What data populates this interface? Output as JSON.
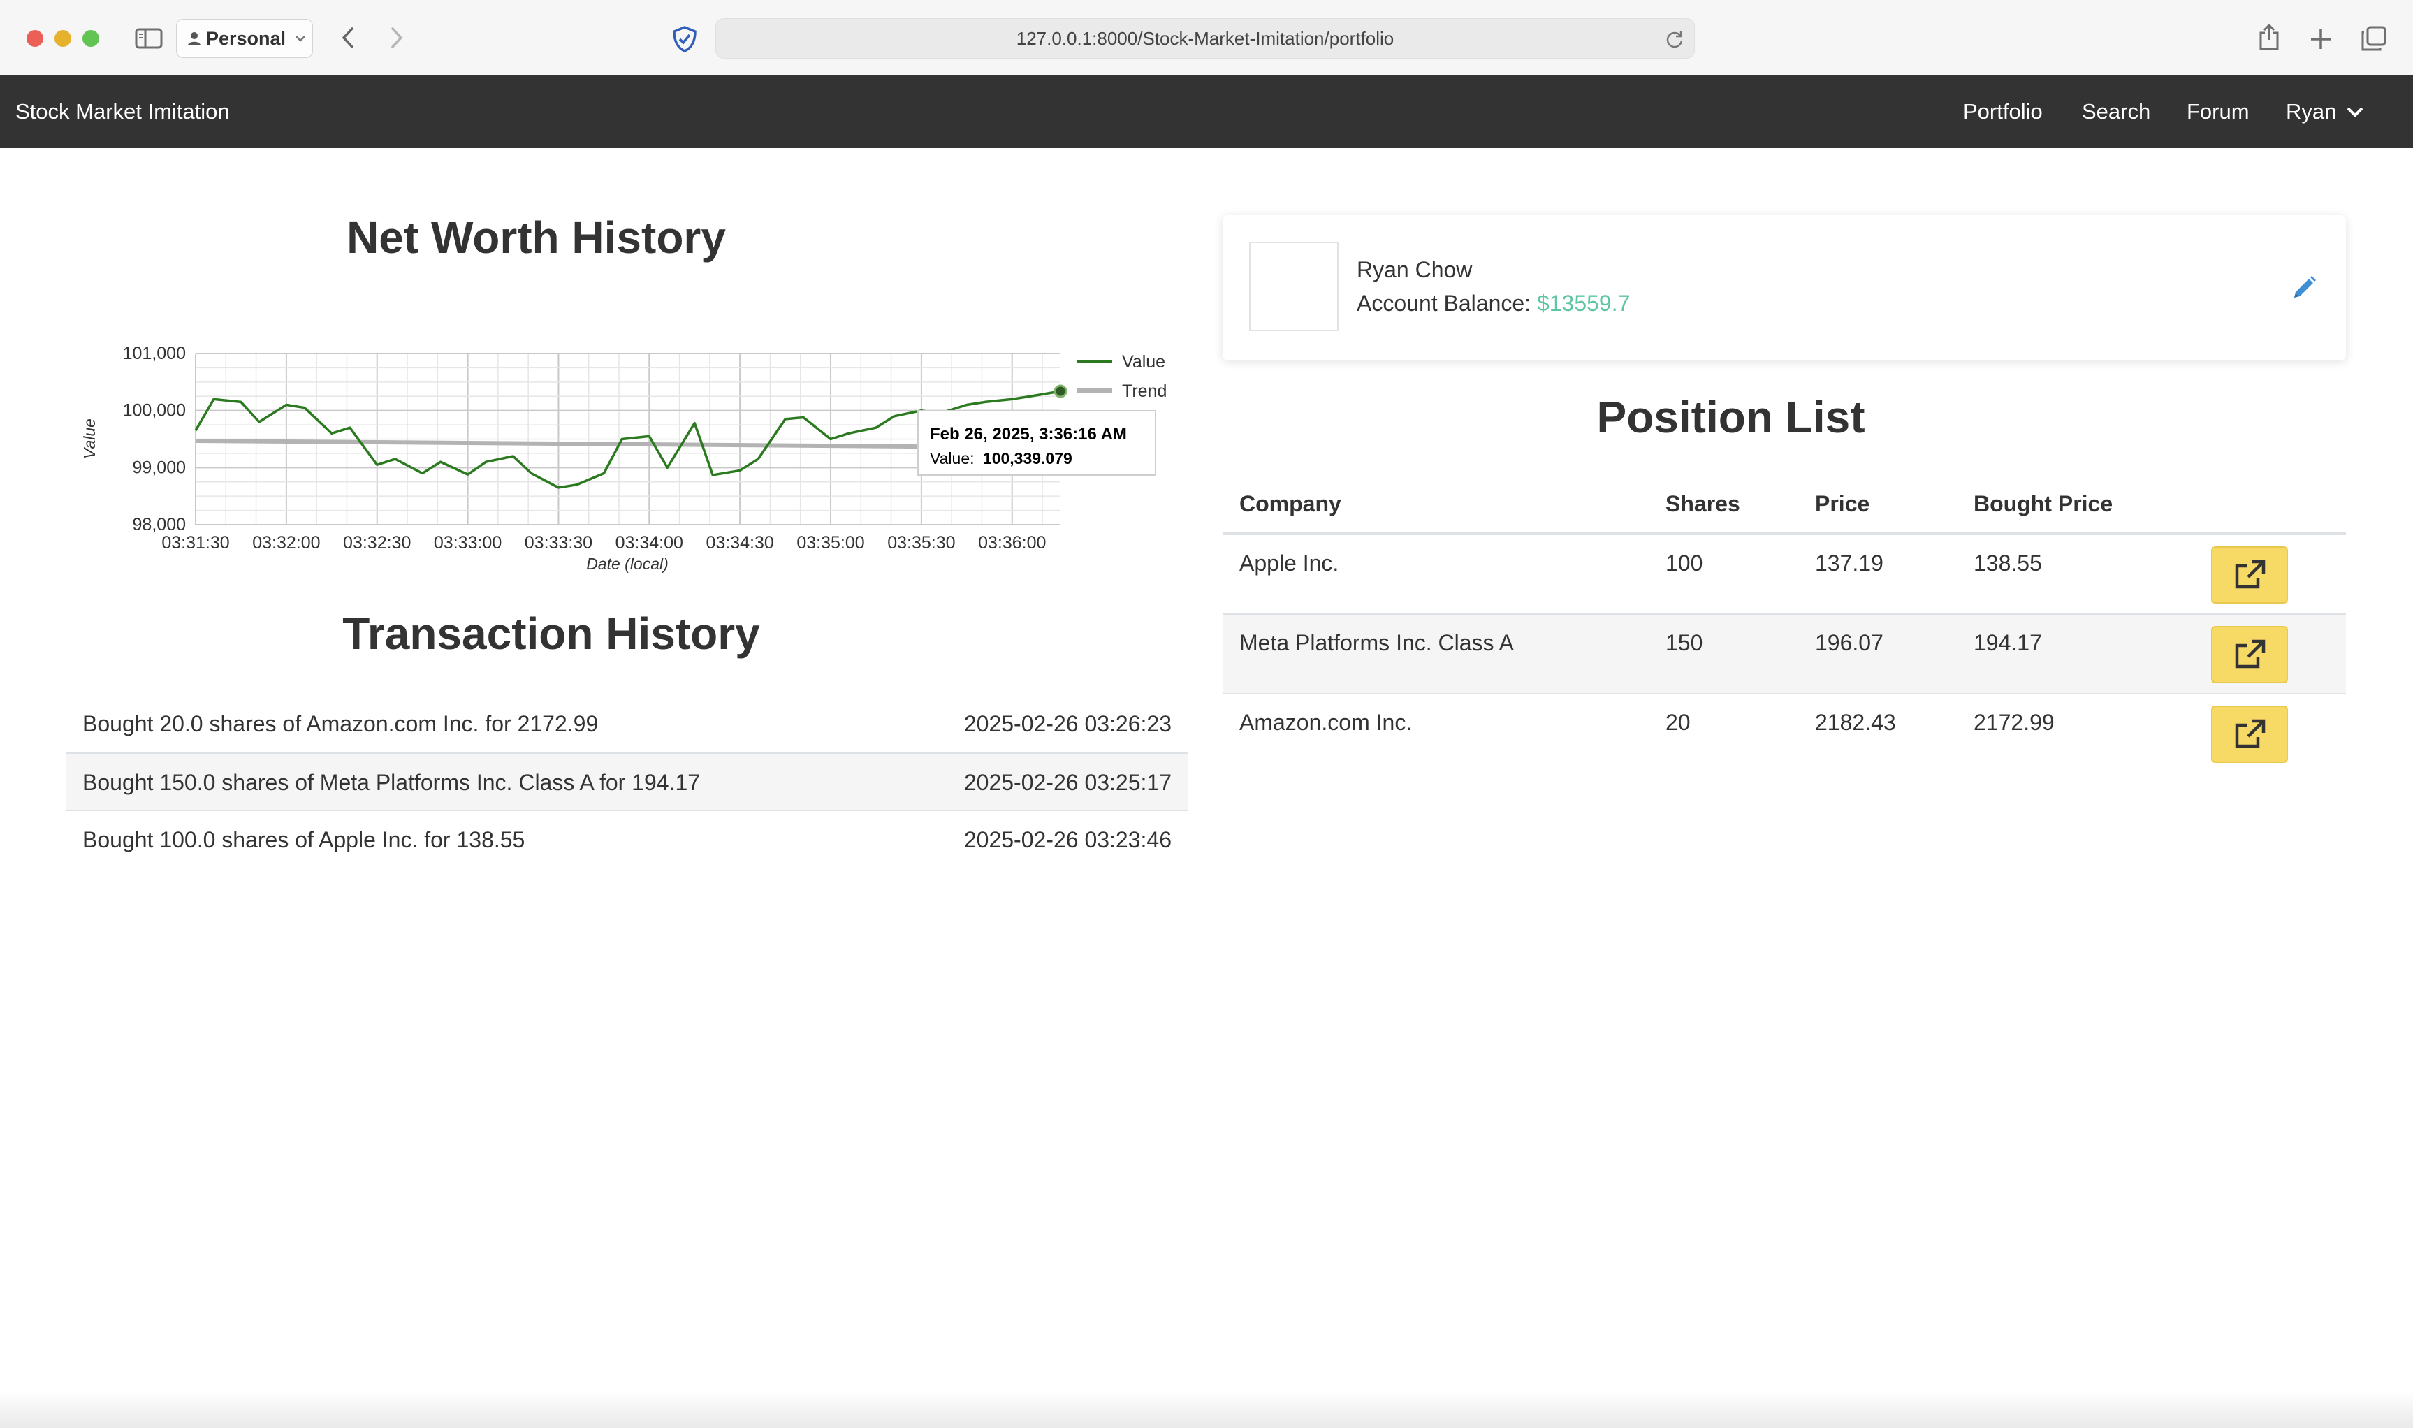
{
  "browser": {
    "profile_label": "Personal",
    "url": "127.0.0.1:8000/Stock-Market-Imitation/portfolio"
  },
  "navbar": {
    "brand": "Stock Market Imitation",
    "links": [
      "Portfolio",
      "Search",
      "Forum"
    ],
    "user_menu": "Ryan"
  },
  "net_worth": {
    "title": "Net Worth History"
  },
  "chart_data": {
    "type": "line",
    "xlabel": "Date (local)",
    "ylabel": "Value",
    "x_ticks": [
      "03:31:30",
      "03:32:00",
      "03:32:30",
      "03:33:00",
      "03:33:30",
      "03:34:00",
      "03:34:30",
      "03:35:00",
      "03:35:30",
      "03:36:00"
    ],
    "y_ticks": [
      "98,000",
      "99,000",
      "100,000",
      "101,000"
    ],
    "xlim": [
      "03:31:30",
      "03:36:16"
    ],
    "ylim": [
      98000,
      101000
    ],
    "grid": true,
    "legend": "right",
    "series": [
      {
        "name": "Value",
        "color": "#2b7a1f",
        "x": [
          "03:31:30",
          "03:31:36",
          "03:31:45",
          "03:31:51",
          "03:32:00",
          "03:32:06",
          "03:32:15",
          "03:32:21",
          "03:32:30",
          "03:32:36",
          "03:32:45",
          "03:32:51",
          "03:33:00",
          "03:33:06",
          "03:33:15",
          "03:33:21",
          "03:33:30",
          "03:33:36",
          "03:33:45",
          "03:33:51",
          "03:34:00",
          "03:34:06",
          "03:34:15",
          "03:34:21",
          "03:34:30",
          "03:34:36",
          "03:34:45",
          "03:34:51",
          "03:35:00",
          "03:35:06",
          "03:35:15",
          "03:35:21",
          "03:35:30",
          "03:35:36",
          "03:35:45",
          "03:35:51",
          "03:36:00",
          "03:36:06",
          "03:36:16"
        ],
        "values": [
          99650,
          100200,
          100150,
          99800,
          100100,
          100050,
          99600,
          99700,
          99050,
          99150,
          98900,
          99100,
          98880,
          99100,
          99200,
          98900,
          98650,
          98700,
          98900,
          99500,
          99550,
          99000,
          99780,
          98870,
          98950,
          99150,
          99850,
          99880,
          99500,
          99600,
          99700,
          99900,
          100000,
          99950,
          100100,
          100150,
          100200,
          100250,
          100339.079
        ]
      },
      {
        "name": "Trend",
        "color": "#b3b3b3",
        "x": [
          "03:31:30",
          "03:36:16"
        ],
        "values": [
          99470,
          99350
        ]
      }
    ],
    "tooltip": {
      "title": "Feb 26, 2025, 3:36:16 AM",
      "label": "Value:",
      "value": "100,339.079"
    }
  },
  "transactions": {
    "title": "Transaction History",
    "rows": [
      {
        "desc": "Bought 20.0 shares of Amazon.com Inc. for 2172.99",
        "date": "2025-02-26 03:26:23"
      },
      {
        "desc": "Bought 150.0 shares of Meta Platforms Inc. Class A for 194.17",
        "date": "2025-02-26 03:25:17"
      },
      {
        "desc": "Bought 100.0 shares of Apple Inc. for 138.55",
        "date": "2025-02-26 03:23:46"
      }
    ]
  },
  "profile": {
    "name": "Ryan Chow",
    "balance_label": "Account Balance:",
    "balance_value": "$13559.7",
    "balance_color": "#5fc6a3"
  },
  "positions": {
    "title": "Position List",
    "headers": [
      "Company",
      "Shares",
      "Price",
      "Bought Price"
    ],
    "rows": [
      {
        "company": "Apple Inc.",
        "shares": "100",
        "price": "137.19",
        "bought": "138.55"
      },
      {
        "company": "Meta Platforms Inc. Class A",
        "shares": "150",
        "price": "196.07",
        "bought": "194.17"
      },
      {
        "company": "Amazon.com Inc.",
        "shares": "20",
        "price": "2182.43",
        "bought": "2172.99"
      }
    ],
    "action_icon": "external-link-icon",
    "action_color": "#f7d965"
  }
}
